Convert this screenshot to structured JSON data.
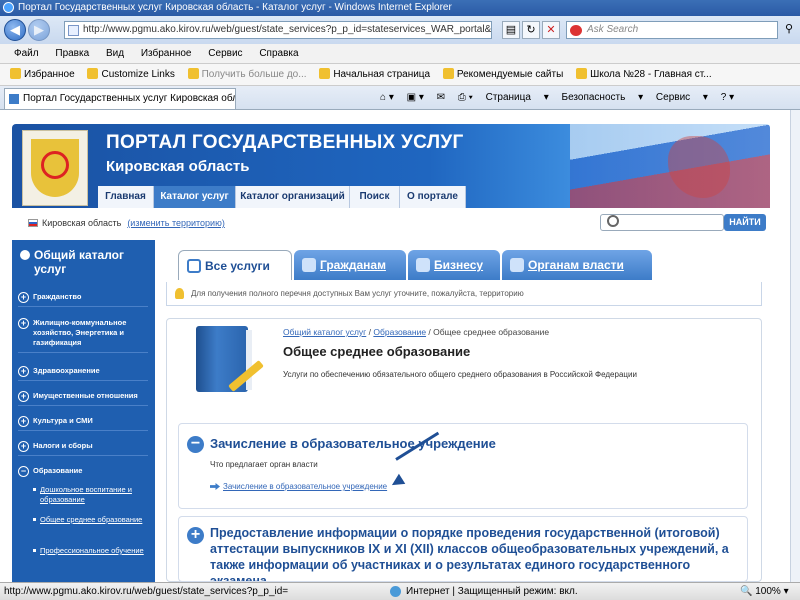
{
  "window": {
    "title": "Портал Государственных услуг Кировская область - Каталог услуг - Windows Internet Explorer"
  },
  "address": {
    "url": "http://www.pgmu.ako.kirov.ru/web/guest/state_services?p_p_id=stateservices_WAR_portal&p_p_",
    "search_placeholder": "Ask Search"
  },
  "menu": [
    "Файл",
    "Правка",
    "Вид",
    "Избранное",
    "Сервис",
    "Справка"
  ],
  "links": {
    "favorites": "Избранное",
    "customize": "Customize Links",
    "more": "Получить больше до...",
    "home": "Начальная страница",
    "recommended": "Рекомендуемые сайты",
    "school": "Школа №28 - Главная ст..."
  },
  "tab": {
    "label": "Портал Государственных услуг Кировская обл..."
  },
  "tools": {
    "page": "Страница",
    "security": "Безопасность",
    "service": "Сервис"
  },
  "site": {
    "title": "ПОРТАЛ ГОСУДАРСТВЕННЫХ УСЛУГ",
    "subtitle": "Кировская область"
  },
  "nav": [
    "Главная",
    "Каталог услуг",
    "Каталог организаций",
    "Поиск",
    "О портале"
  ],
  "region": {
    "name": "Кировская область",
    "change": "(изменить территорию)"
  },
  "search_button": "НАЙТИ",
  "sidebar": {
    "title": "Общий каталог услуг",
    "items": [
      "Гражданство",
      "Жилищно-коммунальное хозяйство, Энергетика и газификация",
      "Здравоохранение",
      "Имущественные отношения",
      "Культура и СМИ",
      "Налоги и сборы",
      "Образование"
    ],
    "subitems": [
      "Дошкольное воспитание и образование",
      "Общее среднее образование",
      "Профессиональное обучение"
    ]
  },
  "content_tabs": [
    "Все услуги",
    "Гражданам",
    "Бизнесу",
    "Органам власти"
  ],
  "hint": "Для получения полного перечня доступных Вам услуг уточните, пожалуйста, территорию",
  "breadcrumb": {
    "root": "Общий каталог услуг",
    "sep1": " / ",
    "mid": "Образование",
    "sep2": " / ",
    "current": "Общее среднее образование"
  },
  "heading": "Общее среднее образование",
  "description": "Услуги по обеспечению обязательного общего среднего образования в Российской Федерации",
  "section1": {
    "title": "Зачисление в образовательное учреждение",
    "label": "Что предлагает орган власти",
    "link": "Зачисление в образовательное учреждение"
  },
  "section2": {
    "title": "Предоставление информации о порядке проведения государственной (итоговой) аттестации выпускников IX и XI (XII) классов общеобразовательных учреждений, а также информации об участниках и о результатах единого государственного экзамена"
  },
  "status": {
    "url": "http://www.pgmu.ako.kirov.ru/web/guest/state_services?p_p_id=",
    "zone": "Интернет | Защищенный режим: вкл.",
    "zoom": "100%"
  }
}
